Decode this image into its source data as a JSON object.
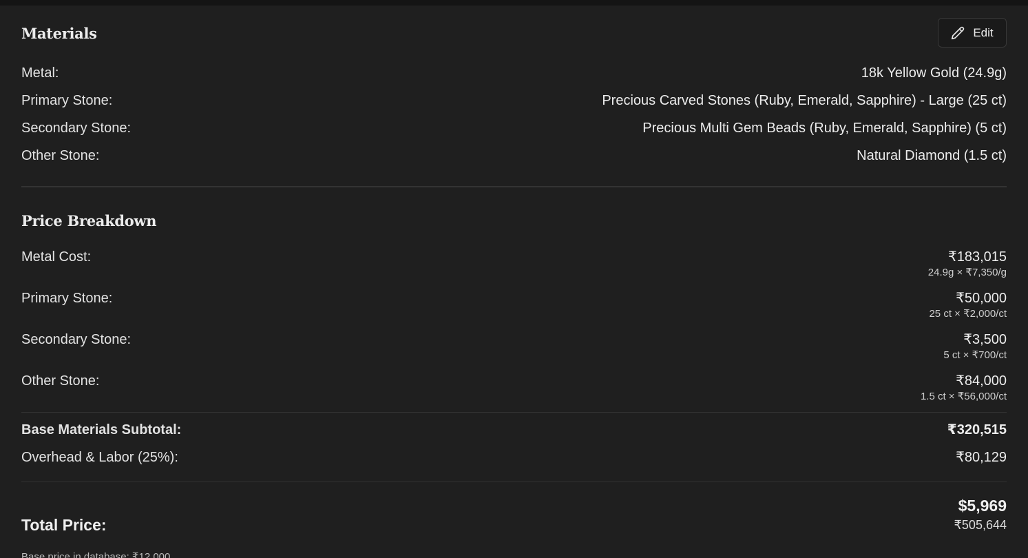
{
  "materials": {
    "title": "Materials",
    "edit_label": "Edit",
    "items": [
      {
        "label": "Metal:",
        "value": "18k Yellow Gold (24.9g)"
      },
      {
        "label": "Primary Stone:",
        "value": "Precious Carved Stones (Ruby, Emerald, Sapphire) - Large (25 ct)"
      },
      {
        "label": "Secondary Stone:",
        "value": "Precious Multi Gem Beads (Ruby, Emerald, Sapphire) (5 ct)"
      },
      {
        "label": "Other Stone:",
        "value": "Natural Diamond (1.5 ct)"
      }
    ]
  },
  "price_breakdown": {
    "title": "Price Breakdown",
    "items": [
      {
        "label": "Metal Cost:",
        "value": "₹183,015",
        "detail": "24.9g × ₹7,350/g"
      },
      {
        "label": "Primary Stone:",
        "value": "₹50,000",
        "detail": "25 ct × ₹2,000/ct"
      },
      {
        "label": "Secondary Stone:",
        "value": "₹3,500",
        "detail": "5 ct × ₹700/ct"
      },
      {
        "label": "Other Stone:",
        "value": "₹84,000",
        "detail": "1.5 ct × ₹56,000/ct"
      }
    ],
    "subtotal": {
      "label": "Base Materials Subtotal:",
      "value": "₹320,515"
    },
    "overhead": {
      "label": "Overhead & Labor (25%):",
      "value": "₹80,129"
    },
    "total": {
      "label": "Total Price:",
      "usd": "$5,969",
      "inr": "₹505,644"
    },
    "note": "Base price in database: ₹12,000"
  },
  "icons": {
    "edit": "pencil-icon"
  },
  "colors": {
    "background": "#1f1f1f",
    "text": "#ececec",
    "divider": "#333333"
  }
}
